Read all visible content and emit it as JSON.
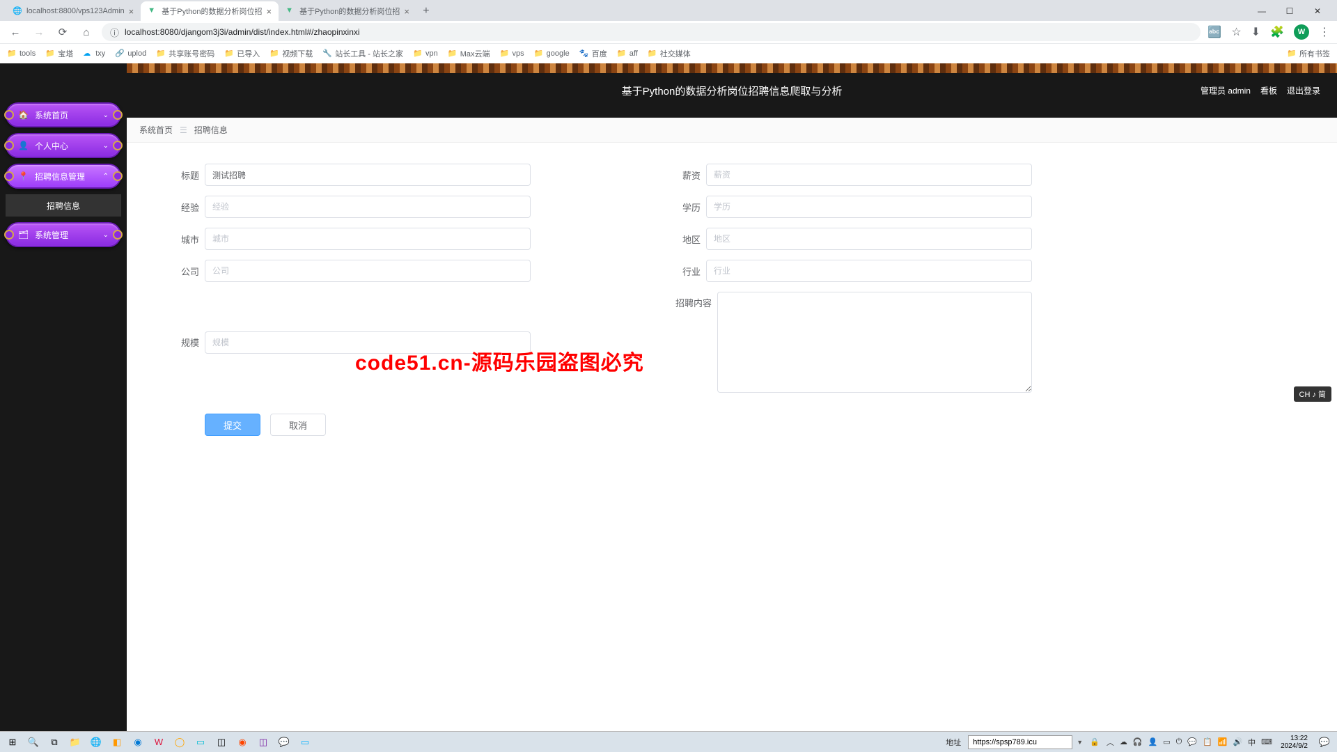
{
  "browser": {
    "tabs": [
      {
        "title": "localhost:8800/vps123Admin",
        "favicon": "generic"
      },
      {
        "title": "基于Python的数据分析岗位招",
        "favicon": "vue"
      },
      {
        "title": "基于Python的数据分析岗位招",
        "favicon": "vue"
      }
    ],
    "active_tab": 1,
    "url": "localhost:8080/djangom3j3i/admin/dist/index.html#/zhaopinxinxi",
    "bookmarks": [
      "tools",
      "宝塔",
      "txy",
      "uplod",
      "共享账号密码",
      "已导入",
      "视频下载",
      "站长工具 - 站长之家",
      "vpn",
      "Max云端",
      "vps",
      "google",
      "百度",
      "aff",
      "社交媒体"
    ],
    "bookmark_right": "所有书签"
  },
  "app": {
    "title": "基于Python的数据分析岗位招聘信息爬取与分析",
    "header_right": {
      "admin": "管理员 admin",
      "kanban": "看板",
      "logout": "退出登录"
    },
    "sidebar": {
      "items": [
        {
          "label": "系统首页",
          "icon": "home"
        },
        {
          "label": "个人中心",
          "icon": "user"
        },
        {
          "label": "招聘信息管理",
          "icon": "pin",
          "active": true,
          "sub": "招聘信息"
        },
        {
          "label": "系统管理",
          "icon": "grid"
        }
      ]
    },
    "breadcrumb": {
      "home": "系统首页",
      "current": "招聘信息"
    },
    "form": {
      "title": {
        "label": "标题",
        "value": "测试招聘"
      },
      "salary": {
        "label": "薪资",
        "placeholder": "薪资"
      },
      "exp": {
        "label": "经验",
        "placeholder": "经验"
      },
      "edu": {
        "label": "学历",
        "placeholder": "学历"
      },
      "city": {
        "label": "城市",
        "placeholder": "城市"
      },
      "region": {
        "label": "地区",
        "placeholder": "地区"
      },
      "company": {
        "label": "公司",
        "placeholder": "公司"
      },
      "industry": {
        "label": "行业",
        "placeholder": "行业"
      },
      "scale": {
        "label": "规模",
        "placeholder": "规模"
      },
      "content": {
        "label": "招聘内容",
        "placeholder": ""
      }
    },
    "buttons": {
      "submit": "提交",
      "cancel": "取消"
    }
  },
  "watermark": "code51.cn",
  "red_watermark": "code51.cn-源码乐园盗图必究",
  "ime": "CH ♪ 简",
  "taskbar": {
    "url_label": "地址",
    "url_value": "https://spsp789.icu",
    "clock": {
      "time": "13:22",
      "date": "2024/9/2"
    }
  }
}
